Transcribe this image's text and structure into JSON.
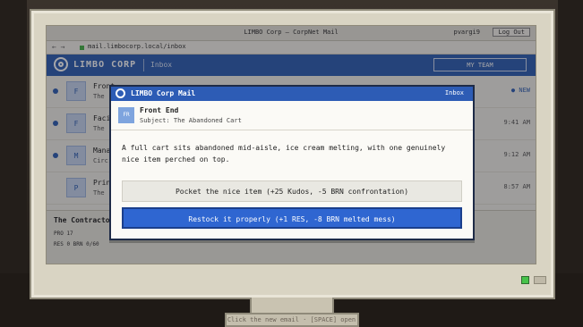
{
  "window": {
    "title": "LIMBO Corp — CorpNet Mail",
    "user": "pvargi9",
    "logout_label": "Log Out"
  },
  "urlbar": {
    "nav": "← →",
    "url": "mail.limbocorp.local/inbox"
  },
  "app": {
    "brand": "LIMBO CORP",
    "section": "Inbox",
    "team_button": "MY TEAM"
  },
  "mail_list": [
    {
      "avatar": "F",
      "from": "Front",
      "subject": "The",
      "time": "● NEW"
    },
    {
      "avatar": "F",
      "from": "Faci",
      "subject": "The",
      "time": "9:41 AM"
    },
    {
      "avatar": "M",
      "from": "Mana",
      "subject": "Circ",
      "time": "9:12 AM"
    },
    {
      "avatar": "P",
      "from": "Prin",
      "subject": "The",
      "time": "8:57 AM"
    }
  ],
  "contract": {
    "heading": "The Contractor",
    "line1": "PRO   17",
    "line2": "RES    0                       BRN    0/60"
  },
  "modal": {
    "title": "LIMBO Corp Mail",
    "tag": "Inbox",
    "sender_badge": "FR",
    "sender_name": "Front End",
    "subject": "Subject: The Abandoned Cart",
    "body": "A full cart sits abandoned mid-aisle, ice cream melting, with one genuinely nice item perched on top.",
    "option1": "Pocket the nice item  (+25 Kudos, -5 BRN confrontation)",
    "option2": "Restock it properly  (+1 RES, -8 BRN melted mess)"
  },
  "hint": "Click the new email · [SPACE] open",
  "colors": {
    "accent": "#2f5fb3",
    "selected_option": "#2f66d1",
    "monitor_bezel": "#d9d4c3"
  }
}
